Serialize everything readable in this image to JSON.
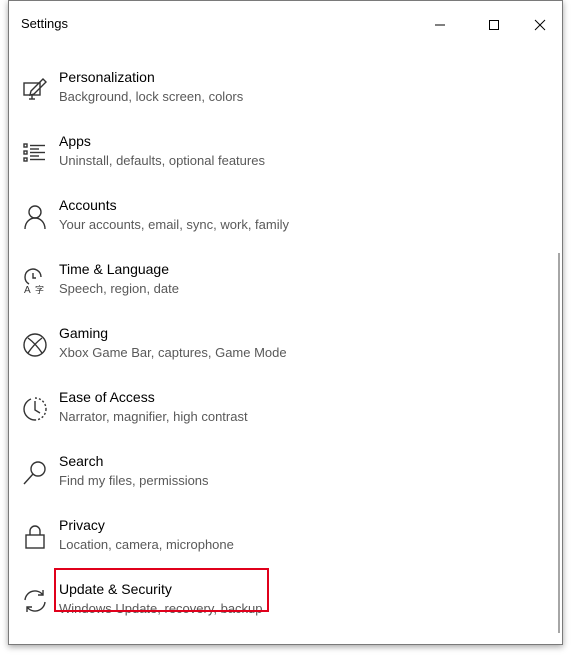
{
  "window": {
    "title": "Settings"
  },
  "caption_buttons": {
    "minimize": "minimize-icon",
    "maximize": "maximize-icon",
    "close": "close-icon"
  },
  "items": [
    {
      "label": "Personalization",
      "desc": "Background, lock screen, colors",
      "icon": "personalization-icon"
    },
    {
      "label": "Apps",
      "desc": "Uninstall, defaults, optional features",
      "icon": "apps-icon"
    },
    {
      "label": "Accounts",
      "desc": "Your accounts, email, sync, work, family",
      "icon": "accounts-icon"
    },
    {
      "label": "Time & Language",
      "desc": "Speech, region, date",
      "icon": "time-language-icon"
    },
    {
      "label": "Gaming",
      "desc": "Xbox Game Bar, captures, Game Mode",
      "icon": "gaming-icon"
    },
    {
      "label": "Ease of Access",
      "desc": "Narrator, magnifier, high contrast",
      "icon": "ease-of-access-icon"
    },
    {
      "label": "Search",
      "desc": "Find my files, permissions",
      "icon": "search-icon"
    },
    {
      "label": "Privacy",
      "desc": "Location, camera, microphone",
      "icon": "privacy-icon"
    },
    {
      "label": "Update & Security",
      "desc": "Windows Update, recovery, backup",
      "icon": "update-security-icon"
    }
  ],
  "colors": {
    "highlight_border": "#e0001b",
    "description_text": "#595959"
  }
}
